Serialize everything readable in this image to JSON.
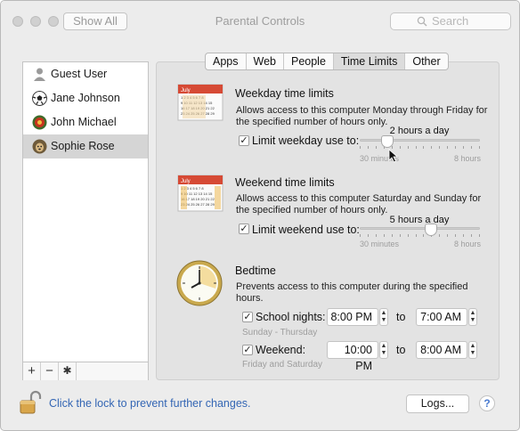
{
  "window": {
    "title": "Parental Controls",
    "show_all": "Show All",
    "search_placeholder": "Search"
  },
  "sidebar": {
    "users": [
      {
        "name": "Guest User"
      },
      {
        "name": "Jane Johnson"
      },
      {
        "name": "John Michael"
      },
      {
        "name": "Sophie Rose"
      }
    ],
    "add_label": "+",
    "remove_label": "−",
    "gear_label": "✱"
  },
  "tabs": [
    "Apps",
    "Web",
    "People",
    "Time Limits",
    "Other"
  ],
  "active_tab": "Time Limits",
  "weekday": {
    "title": "Weekday time limits",
    "description": "Allows access to this computer Monday through Friday for the specified number of hours only.",
    "checkbox_label": "Limit weekday use to:",
    "value": "2 hours a day",
    "min_label": "30 minutes",
    "max_label": "8 hours",
    "calendar_month": "July",
    "level": 0.2
  },
  "weekend": {
    "title": "Weekend time limits",
    "description": "Allows access to this computer Saturday and Sunday for the specified number of hours only.",
    "checkbox_label": "Limit weekend use to:",
    "value": "5 hours a day",
    "min_label": "30 minutes",
    "max_label": "8 hours",
    "calendar_month": "July",
    "level": 0.6
  },
  "bedtime": {
    "title": "Bedtime",
    "description": "Prevents access to this computer during the specified hours.",
    "school": {
      "label": "School nights:",
      "from": "8:00 PM",
      "to": "7:00 AM",
      "sub": "Sunday - Thursday"
    },
    "weekend": {
      "label": "Weekend:",
      "from": "10:00 PM",
      "to": "8:00 AM",
      "sub": "Friday and Saturday"
    },
    "to_label": "to"
  },
  "footer": {
    "lock_text": "Click the lock to prevent further changes.",
    "logs_label": "Logs...",
    "help_label": "?"
  }
}
